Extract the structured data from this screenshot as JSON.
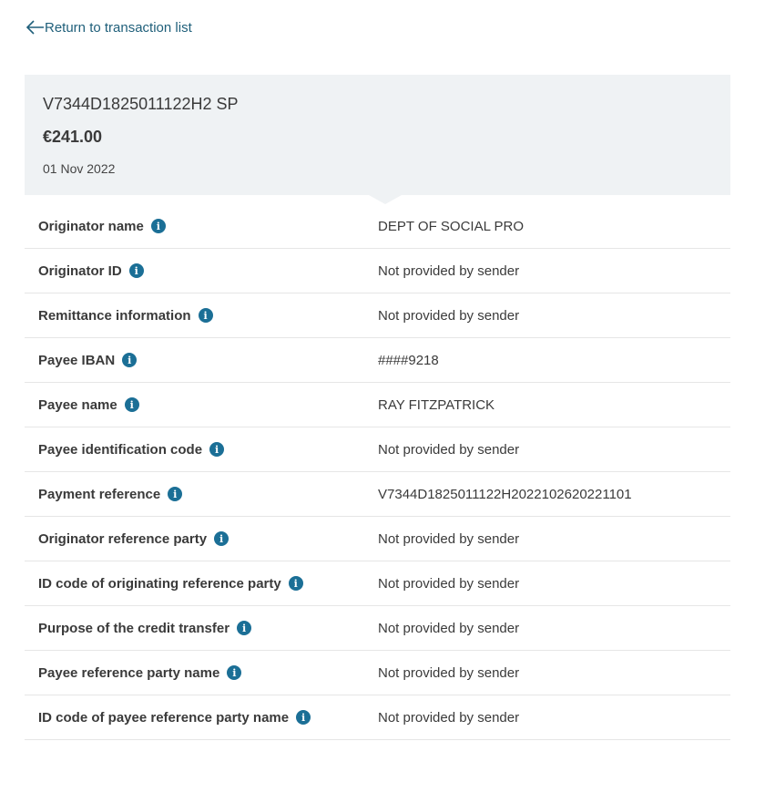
{
  "back_link": {
    "label": "Return to transaction list"
  },
  "summary": {
    "reference": "V7344D1825011122H2 SP",
    "amount": "€241.00",
    "date": "01 Nov 2022"
  },
  "details": [
    {
      "label": "Originator name",
      "value": "DEPT OF SOCIAL PRO"
    },
    {
      "label": "Originator ID",
      "value": "Not provided by sender"
    },
    {
      "label": "Remittance information",
      "value": "Not provided by sender"
    },
    {
      "label": "Payee IBAN",
      "value": "####9218"
    },
    {
      "label": "Payee name",
      "value": "RAY FITZPATRICK"
    },
    {
      "label": "Payee identification code",
      "value": "Not provided by sender"
    },
    {
      "label": "Payment reference",
      "value": "V7344D1825011122H2022102620221101"
    },
    {
      "label": "Originator reference party",
      "value": "Not provided by sender"
    },
    {
      "label": "ID code of originating reference party",
      "value": "Not provided by sender"
    },
    {
      "label": "Purpose of the credit transfer",
      "value": "Not provided by sender"
    },
    {
      "label": "Payee reference party name",
      "value": "Not provided by sender"
    },
    {
      "label": "ID code of payee reference party name",
      "value": "Not provided by sender"
    }
  ],
  "icons": {
    "back": "arrow-left-icon",
    "info": "info-icon"
  },
  "colors": {
    "accent": "#1b6f96",
    "link": "#1f5f7a",
    "summary_bg": "#eff2f4"
  }
}
